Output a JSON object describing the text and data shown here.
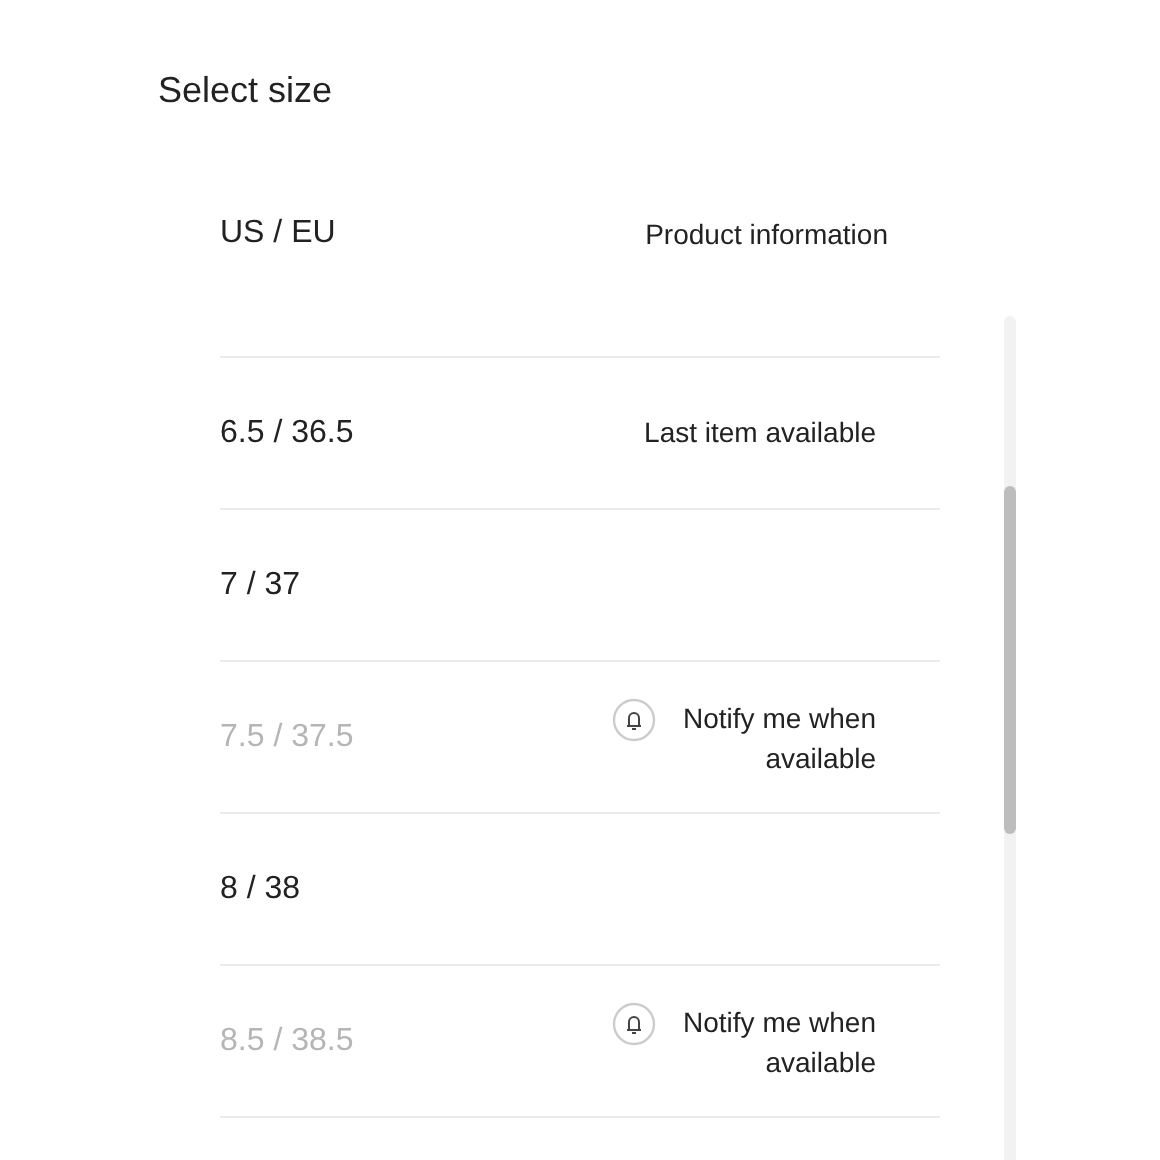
{
  "title": "Select size",
  "columns": [
    "US / EU",
    "Product information"
  ],
  "sizes": [
    {
      "size": "6.5 / 36.5",
      "available": true,
      "kind": "note",
      "info": "Last item available"
    },
    {
      "size": "7 / 37",
      "available": true,
      "kind": "plain"
    },
    {
      "size": "7.5 / 37.5",
      "available": false,
      "kind": "notify",
      "info": "Notify me when available"
    },
    {
      "size": "8 / 38",
      "available": true,
      "kind": "plain"
    },
    {
      "size": "8.5 / 38.5",
      "available": false,
      "kind": "notify",
      "info": "Notify me when available"
    }
  ]
}
